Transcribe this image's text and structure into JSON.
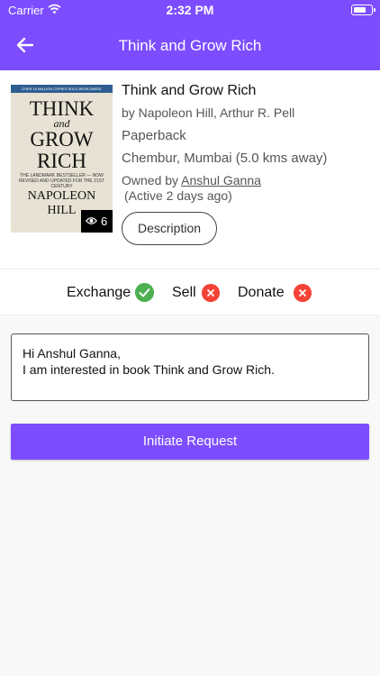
{
  "status_bar": {
    "carrier": "Carrier",
    "time": "2:32 PM"
  },
  "header": {
    "title": "Think and Grow Rich"
  },
  "book": {
    "cover": {
      "banner": "OVER 15 MILLION COPIES SOLD WORLDWIDE",
      "title_line1": "THINK",
      "title_line2": "and",
      "title_line3": "GROW",
      "title_line4": "RICH",
      "subtitle": "THE LANDMARK BESTSELLER — NOW REVISED AND UPDATED FOR THE 21ST CENTURY",
      "author_line1": "NAPOLEON",
      "author_line2": "HILL"
    },
    "view_count": "6",
    "title": "Think and Grow Rich",
    "authors": "by Napoleon Hill, Arthur R. Pell",
    "format": "Paperback",
    "location": "Chembur, Mumbai (5.0 kms away)",
    "owned_by_prefix": "Owned by",
    "owner_name": "Anshul Ganna",
    "active_text": "(Active 2 days ago)",
    "description_button": "Description"
  },
  "options": [
    {
      "label": "Exchange",
      "available": true
    },
    {
      "label": "Sell",
      "available": false
    },
    {
      "label": "Donate",
      "available": false
    }
  ],
  "message": {
    "line1": "Hi Anshul Ganna,",
    "line2": "I am interested in book Think and Grow Rich."
  },
  "cta": {
    "label": "Initiate Request"
  },
  "colors": {
    "primary": "#7c4dff",
    "available": "#4caf50",
    "unavailable": "#f44336"
  }
}
